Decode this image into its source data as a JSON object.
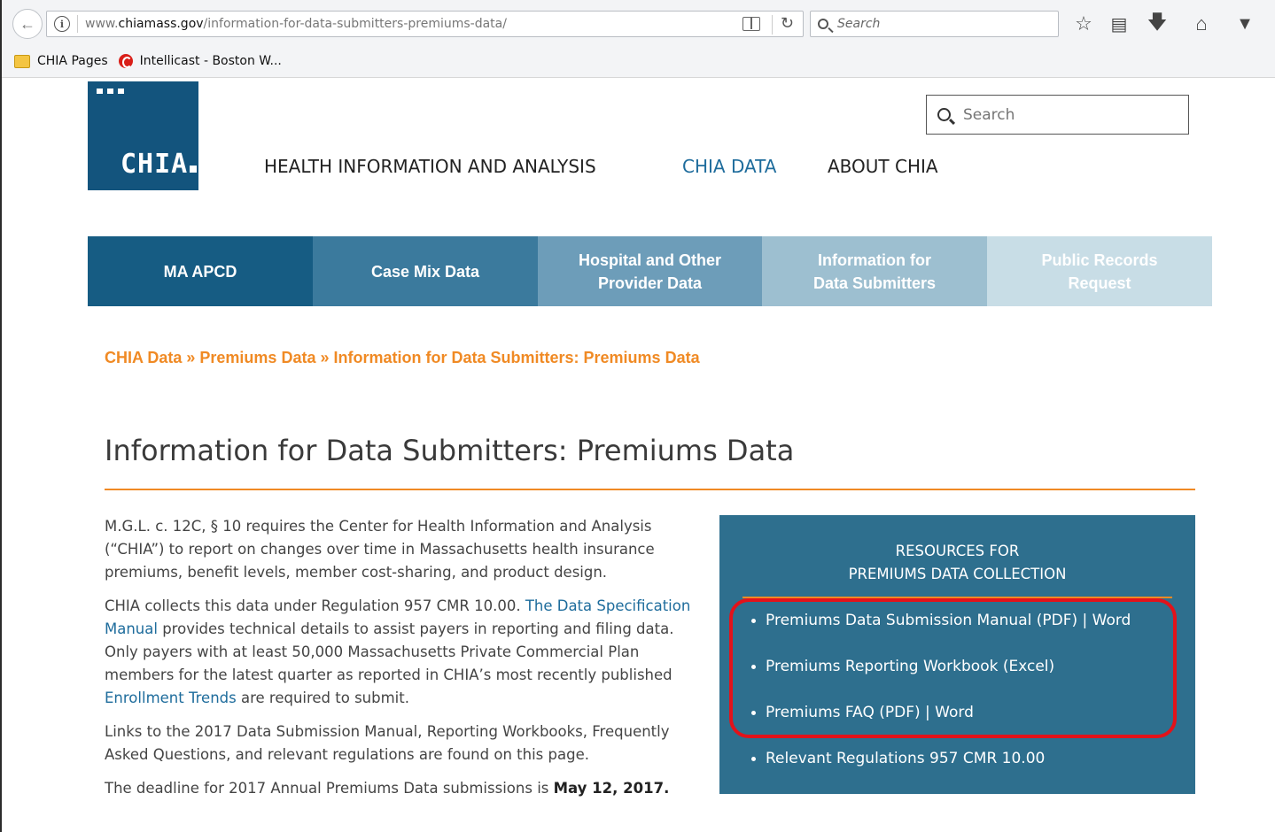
{
  "browser": {
    "url_prefix": "www.",
    "url_domain": "chiamass.gov",
    "url_path": "/information-for-data-submitters-premiums-data/",
    "search_placeholder": "Search",
    "bookmarks": [
      {
        "label": "CHIA Pages"
      },
      {
        "label": "Intellicast - Boston W..."
      }
    ]
  },
  "site": {
    "logo_text": "CHIA",
    "search_placeholder": "Search",
    "nav": [
      {
        "label": "HEALTH INFORMATION AND ANALYSIS"
      },
      {
        "label": "CHIA DATA"
      },
      {
        "label": "ABOUT CHIA"
      }
    ],
    "section_tabs": [
      {
        "label": "MA APCD",
        "color": "#165c83"
      },
      {
        "label": "Case Mix Data",
        "color": "#3b7a9d"
      },
      {
        "label_line1": "Hospital and Other",
        "label_line2": "Provider Data",
        "color": "#6d9db9"
      },
      {
        "label_line1": "Information for",
        "label_line2": "Data Submitters",
        "color": "#9dbfd0"
      },
      {
        "label_line1": "Public Records",
        "label_line2": "Request",
        "color": "#c8dde6"
      }
    ]
  },
  "breadcrumb": {
    "items": [
      "CHIA Data",
      "Premiums Data",
      "Information for Data Submitters: Premiums Data"
    ],
    "separator": "»"
  },
  "page": {
    "title": "Information for Data Submitters: Premiums Data",
    "p1": "M.G.L. c. 12C, § 10 requires the Center for Health Information and Analysis (“CHIA”) to report on changes over time in Massachusetts health insurance premiums, benefit levels, member cost-sharing, and product design.",
    "p2_before": "CHIA collects this data under Regulation 957 CMR 10.00. ",
    "p2_link1": "The Data Specification Manual",
    "p2_middle": " provides technical details to assist payers in reporting and filing data.  Only payers with at least 50,000 Massachusetts Private Commercial Plan members for the latest quarter as reported in CHIA’s most recently published ",
    "p2_link2": "Enrollment Trends",
    "p2_after": " are required to submit.",
    "p3": "Links to the 2017 Data Submission Manual, Reporting Workbooks, Frequently Asked Questions, and relevant regulations are found on this page.",
    "p4_before": "The deadline for 2017 Annual Premiums Data submissions is ",
    "p4_bold": "May 12, 2017."
  },
  "resources": {
    "heading_line1": "RESOURCES FOR",
    "heading_line2": "PREMIUMS DATA COLLECTION",
    "items": [
      {
        "label": "Premiums Data Submission Manual (PDF)  | Word"
      },
      {
        "label": "Premiums Reporting Workbook (Excel)"
      },
      {
        "label": "Premiums FAQ (PDF) | Word"
      },
      {
        "label": "Relevant Regulations 957 CMR 10.00"
      }
    ]
  },
  "colors": {
    "accent_orange": "#f08a24",
    "brand_blue": "#13547d",
    "link_blue": "#1e6c9c",
    "resources_bg": "#2e6f8e",
    "highlight_red": "#e3121a"
  }
}
